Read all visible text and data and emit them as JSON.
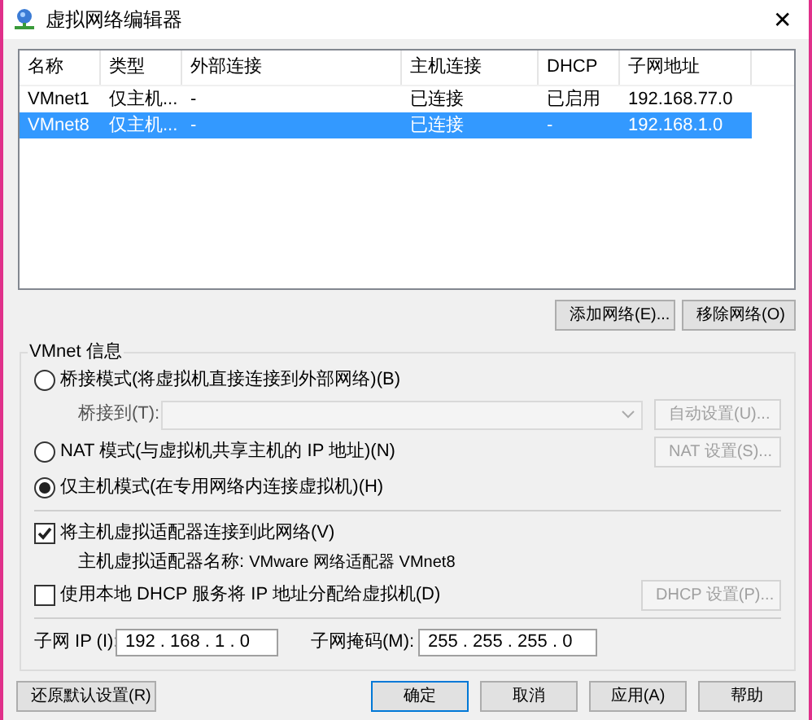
{
  "window": {
    "title": "虚拟网络编辑器",
    "close": "✕"
  },
  "table": {
    "columns": [
      "名称",
      "类型",
      "外部连接",
      "主机连接",
      "DHCP",
      "子网地址"
    ],
    "rows": [
      {
        "cells": [
          "VMnet1",
          "仅主机...",
          "-",
          "已连接",
          "已启用",
          "192.168.77.0"
        ],
        "selected": false
      },
      {
        "cells": [
          "VMnet8",
          "仅主机...",
          "-",
          "已连接",
          "-",
          "192.168.1.0"
        ],
        "selected": true
      }
    ]
  },
  "list_buttons": [
    "添加网络(E)...",
    "移除网络(O)"
  ],
  "group": {
    "title": "VMnet 信息",
    "modes": [
      {
        "label": "桥接模式(将虚拟机直接连接到外部网络)(B)",
        "selected": false
      },
      {
        "label": "NAT 模式(与虚拟机共享主机的 IP 地址)(N)",
        "selected": false
      },
      {
        "label": "仅主机模式(在专用网络内连接虚拟机)(H)",
        "selected": true
      }
    ],
    "bridge_label": "桥接到(T):",
    "auto_button": {
      "label": "自动设置(U)...",
      "disabled": true
    },
    "nat_button": {
      "label": "NAT 设置(S)...",
      "disabled": true
    },
    "connect_adapter": {
      "label": "将主机虚拟适配器连接到此网络(V)",
      "checked": true
    },
    "adapter_name_label": "主机虚拟适配器名称:",
    "adapter_name": "VMware 网络适配器 VMnet8",
    "use_dhcp": {
      "label": "使用本地 DHCP 服务将 IP 地址分配给虚拟机(D)",
      "checked": false
    },
    "dhcp_button": {
      "label": "DHCP 设置(P)...",
      "disabled": true
    },
    "subnet_ip_label": "子网 IP (I):",
    "subnet_ip": "192 . 168 . 1 . 0",
    "subnet_mask_label": "子网掩码(M):",
    "subnet_mask": "255 . 255 . 255 . 0"
  },
  "restore_button": "还原默认设置(R)",
  "footer_buttons": [
    {
      "label": "确定",
      "default": true
    },
    {
      "label": "取消",
      "default": false
    },
    {
      "label": "应用(A)",
      "default": false
    },
    {
      "label": "帮助",
      "default": false
    }
  ]
}
